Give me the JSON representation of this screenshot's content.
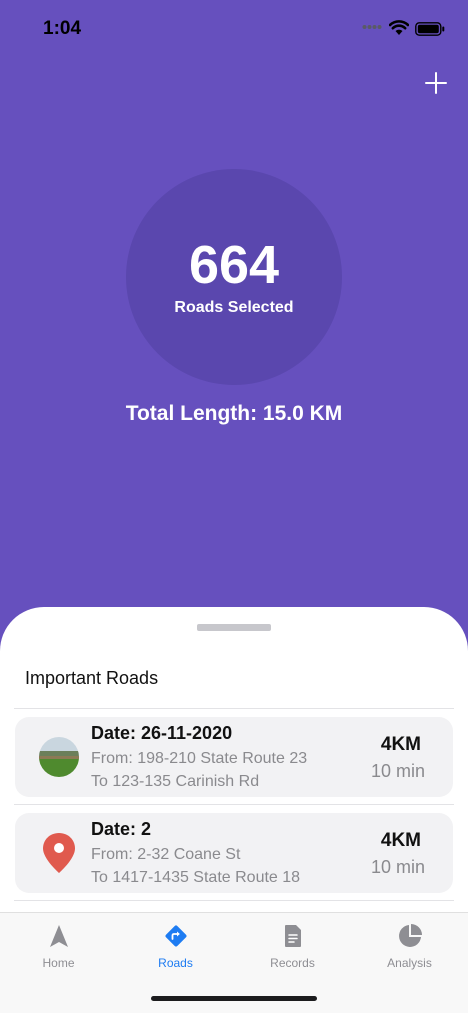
{
  "status_bar": {
    "time": "1:04"
  },
  "summary": {
    "roads_count": "664",
    "roads_label": "Roads Selected",
    "total_length": "Total Length: 15.0 KM"
  },
  "sheet": {
    "title": "Important Roads",
    "roads": [
      {
        "date": "Date: 26-11-2020",
        "from": "From: 198-210 State Route 23",
        "to": "To 123-135 Carinish Rd",
        "distance": "4KM",
        "duration": "10 min",
        "icon": "photo-thumbnail"
      },
      {
        "date": "Date: 2",
        "from": "From: 2-32 Coane St",
        "to": "To 1417-1435 State Route 18",
        "distance": "4KM",
        "duration": "10 min",
        "icon": "map-pin-icon"
      }
    ]
  },
  "tabs": [
    {
      "label": "Home",
      "icon": "navigation-arrow-icon",
      "active": false
    },
    {
      "label": "Roads",
      "icon": "directions-icon",
      "active": true
    },
    {
      "label": "Records",
      "icon": "document-icon",
      "active": false
    },
    {
      "label": "Analysis",
      "icon": "pie-chart-icon",
      "active": false
    }
  ],
  "colors": {
    "background": "#6650be",
    "circle": "#5a47ae",
    "accent": "#1e7cf2",
    "pin": "#e05a4e"
  }
}
